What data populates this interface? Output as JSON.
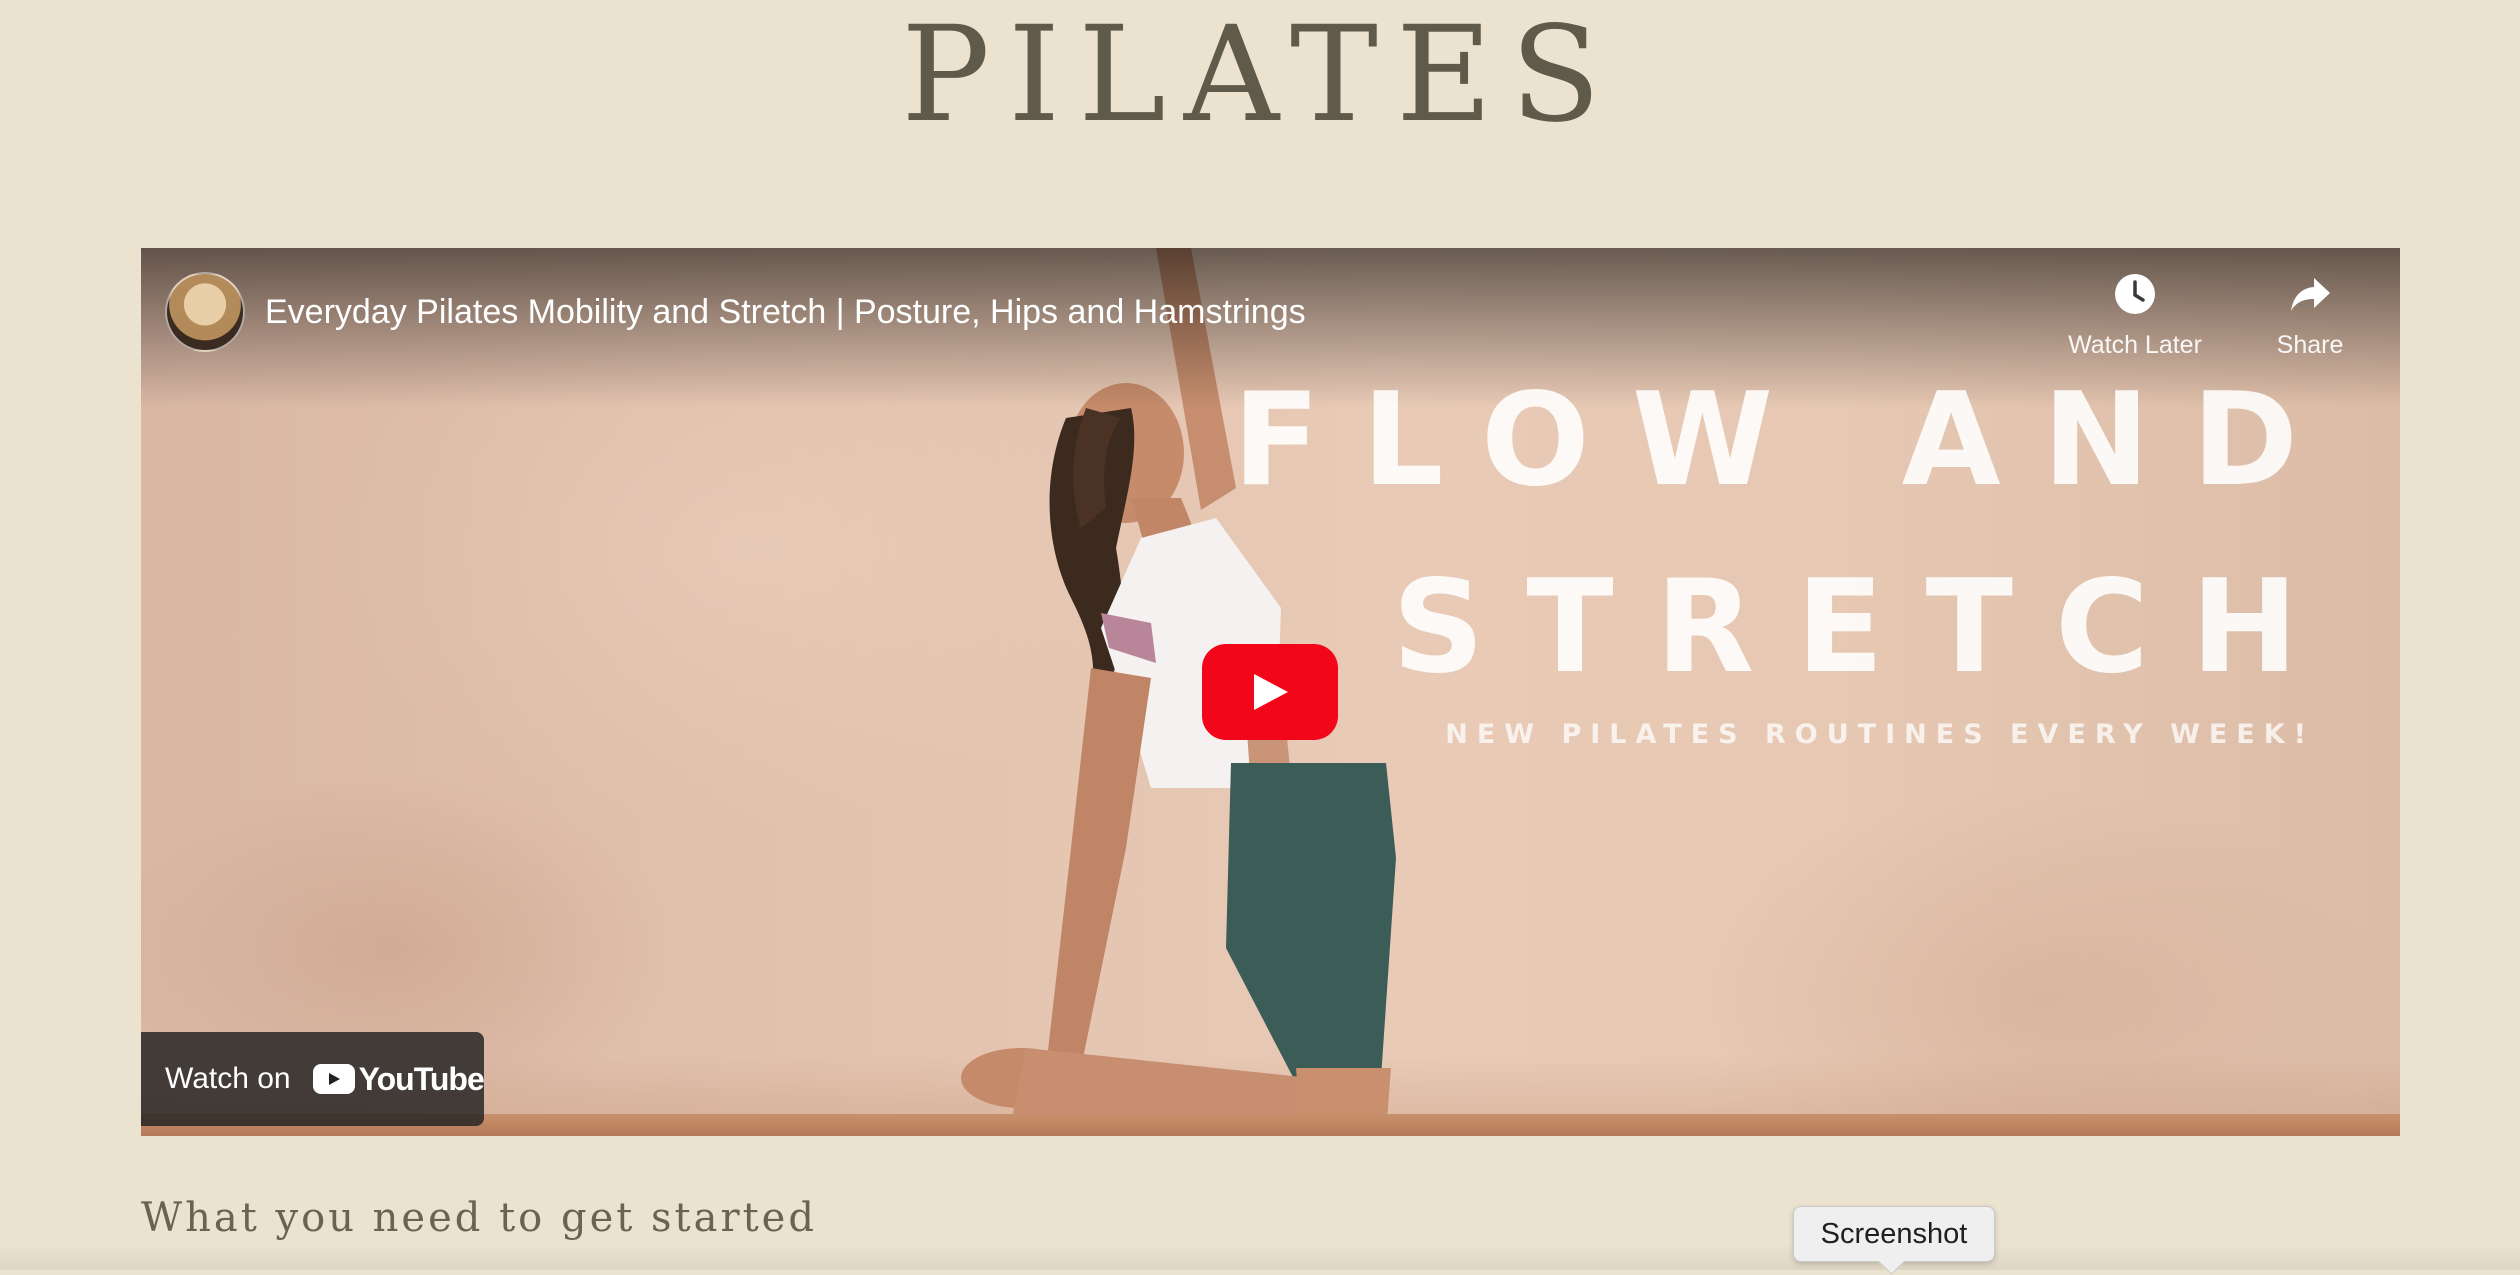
{
  "page": {
    "title": "PILATES",
    "section_heading": "What you need to get started"
  },
  "video": {
    "title": "Everyday Pilates Mobility and Stretch | Posture, Hips and Hamstrings",
    "thumbnail_text": {
      "line1": "FLOW AND",
      "line2": "STRETCH",
      "tagline": "NEW PILATES ROUTINES EVERY WEEK!"
    },
    "actions": {
      "watch_later": "Watch Later",
      "share": "Share"
    },
    "watch_on": {
      "label": "Watch on",
      "brand": "YouTube"
    },
    "colors": {
      "play_button": "#f2061a"
    }
  },
  "tooltip": {
    "text": "Screenshot"
  }
}
